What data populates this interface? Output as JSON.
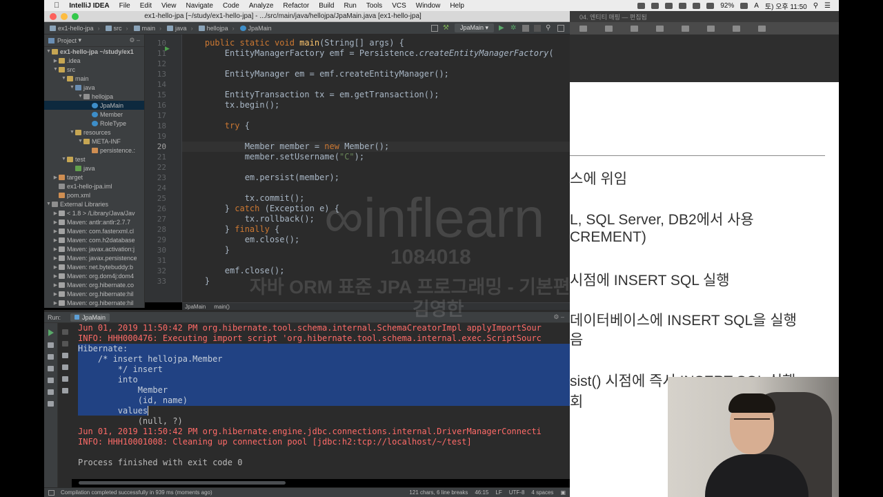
{
  "menubar": {
    "app_name": "IntelliJ IDEA",
    "items": [
      "File",
      "Edit",
      "View",
      "Navigate",
      "Code",
      "Analyze",
      "Refactor",
      "Build",
      "Run",
      "Tools",
      "VCS",
      "Window",
      "Help"
    ],
    "battery": "92%",
    "clock": "토) 오후 11:50"
  },
  "window": {
    "title": "ex1-hello-jpa [~/study/ex1-hello-jpa] - .../src/main/java/hellojpa/JpaMain.java [ex1-hello-jpa]"
  },
  "breadcrumbs": [
    "ex1-hello-jpa",
    "src",
    "main",
    "java",
    "hellojpa",
    "JpaMain"
  ],
  "run_config": "JpaMain",
  "project": {
    "header": "Project",
    "tree": [
      {
        "label": "ex1-hello-jpa ~/study/ex1",
        "icon": "folder-icon"
      },
      {
        "label": ".idea",
        "icon": "folder-icon"
      },
      {
        "label": "src",
        "icon": "folder-icon"
      },
      {
        "label": "main",
        "icon": "folder-icon"
      },
      {
        "label": "java",
        "icon": "source-folder-icon"
      },
      {
        "label": "hellojpa",
        "icon": "package-icon"
      },
      {
        "label": "JpaMain",
        "icon": "class-icon"
      },
      {
        "label": "Member",
        "icon": "class-icon"
      },
      {
        "label": "RoleType",
        "icon": "class-icon"
      },
      {
        "label": "resources",
        "icon": "folder-icon"
      },
      {
        "label": "META-INF",
        "icon": "folder-icon"
      },
      {
        "label": "persistence.:",
        "icon": "xml-file-icon"
      },
      {
        "label": "test",
        "icon": "folder-icon"
      },
      {
        "label": "java",
        "icon": "test-folder-icon"
      },
      {
        "label": "target",
        "icon": "folder-icon"
      },
      {
        "label": "ex1-hello-jpa.iml",
        "icon": "module-file-icon"
      },
      {
        "label": "pom.xml",
        "icon": "maven-file-icon"
      },
      {
        "label": "External Libraries",
        "icon": "library-icon"
      },
      {
        "label": "< 1.8 > /Library/Java/Jav",
        "icon": "jdk-icon"
      },
      {
        "label": "Maven: antlr:antlr:2.7.7",
        "icon": "jar-icon"
      },
      {
        "label": "Maven: com.fasterxml.cl",
        "icon": "jar-icon"
      },
      {
        "label": "Maven: com.h2database",
        "icon": "jar-icon"
      },
      {
        "label": "Maven: javax.activation:j",
        "icon": "jar-icon"
      },
      {
        "label": "Maven: javax.persistence",
        "icon": "jar-icon"
      },
      {
        "label": "Maven: net.bytebuddy:b",
        "icon": "jar-icon"
      },
      {
        "label": "Maven: org.dom4j:dom4",
        "icon": "jar-icon"
      },
      {
        "label": "Maven: org.hibernate.co",
        "icon": "jar-icon"
      },
      {
        "label": "Maven: org.hibernate:hil",
        "icon": "jar-icon"
      },
      {
        "label": "Maven: org.hibernate:hil",
        "icon": "jar-icon"
      }
    ]
  },
  "editor": {
    "line_numbers": [
      "10",
      "11",
      "12",
      "13",
      "14",
      "15",
      "16",
      "17",
      "18",
      "19",
      "20",
      "21",
      "22",
      "23",
      "24",
      "25",
      "26",
      "27",
      "28",
      "29",
      "30",
      "31",
      "32",
      "33"
    ],
    "lines": [
      "    public static void main(String[] args) {",
      "        EntityManagerFactory emf = Persistence.createEntityManagerFactory(",
      "",
      "        EntityManager em = emf.createEntityManager();",
      "",
      "        EntityTransaction tx = em.getTransaction();",
      "        tx.begin();",
      "",
      "        try {",
      "",
      "            Member member = new Member();",
      "            member.setUsername(\"C\");",
      "",
      "            em.persist(member);",
      "",
      "            tx.commit();",
      "        } catch (Exception e) {",
      "            tx.rollback();",
      "        } finally {",
      "            em.close();",
      "        }",
      "",
      "        emf.close();",
      "    }"
    ],
    "footer_crumbs": [
      "JpaMain",
      "main()"
    ]
  },
  "run": {
    "label": "Run:",
    "tab": "JpaMain",
    "console": [
      "Jun 01, 2019 11:50:42 PM org.hibernate.tool.schema.internal.SchemaCreatorImpl applyImportSour",
      "INFO: HHH000476: Executing import script 'org.hibernate.tool.schema.internal.exec.ScriptSourc",
      "Hibernate: ",
      "    /* insert hellojpa.Member",
      "        */ insert ",
      "        into",
      "            Member",
      "            (id, name) ",
      "        values",
      "            (null, ?)",
      "Jun 01, 2019 11:50:42 PM org.hibernate.engine.jdbc.connections.internal.DriverManagerConnecti",
      "INFO: HHH10001008: Cleaning up connection pool [jdbc:h2:tcp://localhost/~/test]",
      "",
      "Process finished with exit code 0"
    ]
  },
  "status": {
    "message": "Compilation completed successfully in 939 ms (moments ago)",
    "selection": "121 chars, 6 line breaks",
    "position": "46:15",
    "line_sep": "LF",
    "encoding": "UTF-8",
    "indent": "4 spaces"
  },
  "slide": {
    "title_bar": "04. 엔티티 매핑 — 편집됨",
    "lines": [
      "스에 위임",
      "L, SQL Server, DB2에서 사용",
      "CREMENT)",
      " 시점에 INSERT SQL 실행",
      "데이터베이스에 INSERT SQL을 실행",
      "음",
      "sist() 시점에 즉시 INSERT SQL 실행",
      "회"
    ]
  },
  "watermark": {
    "brand": "inflearn",
    "id": "1084018",
    "course": "자바 ORM 표준 JPA 프로그래밍 - 기본편",
    "author": "김영한"
  }
}
